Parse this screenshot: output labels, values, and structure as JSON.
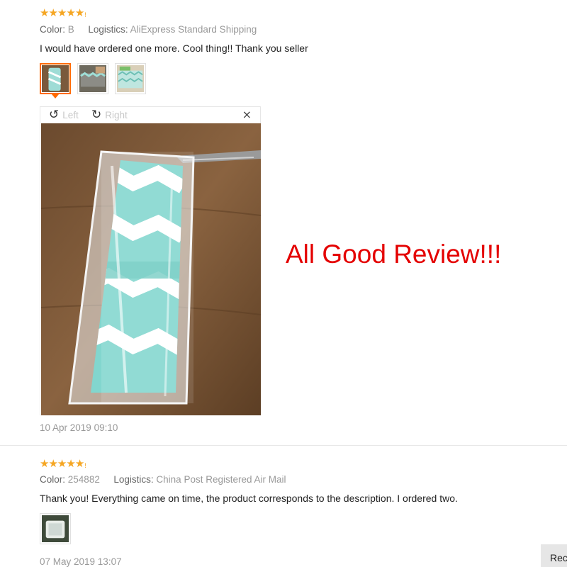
{
  "reviews": [
    {
      "rating": 5,
      "color_label": "Color:",
      "color_value": "B",
      "logistics_label": "Logistics:",
      "logistics_value": "AliExpress Standard Shipping",
      "text": "I would have ordered one more. Cool thing!! Thank you seller",
      "thumbnail_count": 3,
      "selected_thumbnail": 1,
      "date": "10 Apr 2019 09:10"
    },
    {
      "rating": 5,
      "color_label": "Color:",
      "color_value": "254882",
      "logistics_label": "Logistics:",
      "logistics_value": "China Post Registered Air Mail",
      "text": "Thank you! Everything came on time, the product corresponds to the description. I ordered two.",
      "thumbnail_count": 1,
      "date": "07 May 2019 13:07"
    }
  ],
  "viewer": {
    "rotate_left_label": "Left",
    "rotate_right_label": "Right",
    "close_glyph": "×",
    "rotate_left_icon": "rotate-left-icon",
    "rotate_right_icon": "rotate-right-icon"
  },
  "promo_text": "All Good Review!!!",
  "recommend_tab_label": "Rec",
  "colors": {
    "star": "#f5a623",
    "active_thumb_border": "#ff6a00",
    "promo_red": "#e40000",
    "meta_gray": "#999999"
  }
}
